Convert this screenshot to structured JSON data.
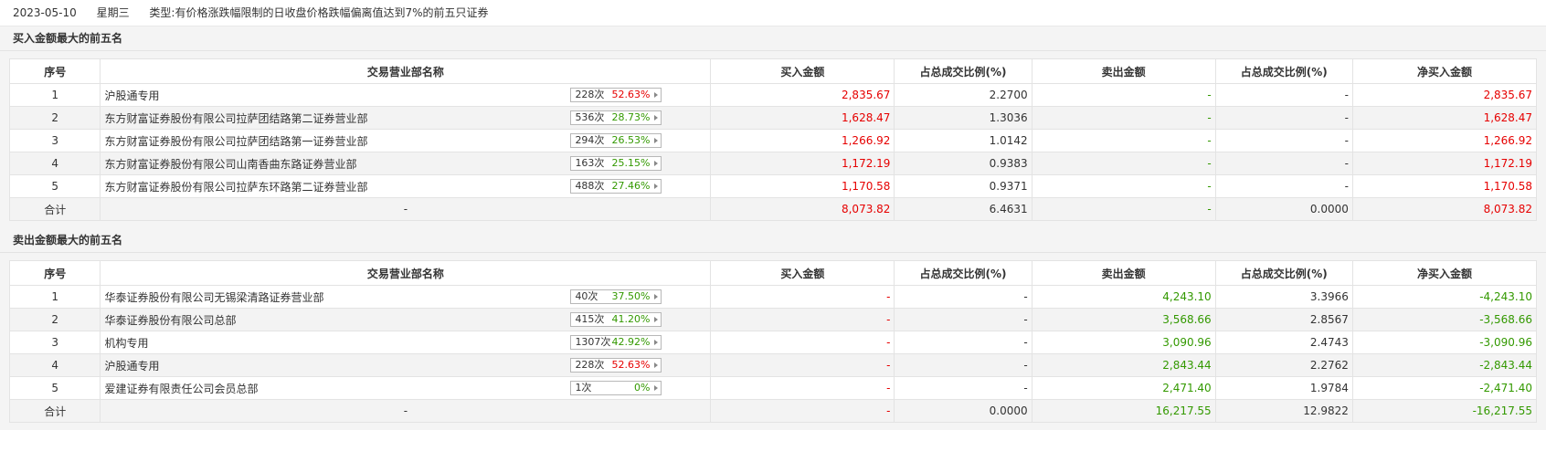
{
  "info": {
    "date": "2023-05-10",
    "weekday": "星期三",
    "type_label": "类型:",
    "type_text": "有价格涨跌幅限制的日收盘价格跌幅偏离值达到7%的前五只证券"
  },
  "columns": {
    "rank": "序号",
    "name": "交易营业部名称",
    "buy": "买入金额",
    "buy_ratio": "占总成交比例(%)",
    "sell": "卖出金额",
    "sell_ratio": "占总成交比例(%)",
    "net": "净买入金额"
  },
  "buy_section": {
    "title": "买入金额最大的前五名",
    "rows": [
      {
        "rank": "1",
        "name": "沪股通专用",
        "times": "228次",
        "pct": "52.63%",
        "pct_color": "red",
        "buy": "2,835.67",
        "buy_ratio": "2.2700",
        "sell": "-",
        "sell_ratio": "-",
        "net": "2,835.67"
      },
      {
        "rank": "2",
        "name": "东方财富证券股份有限公司拉萨团结路第二证券营业部",
        "times": "536次",
        "pct": "28.73%",
        "pct_color": "green",
        "buy": "1,628.47",
        "buy_ratio": "1.3036",
        "sell": "-",
        "sell_ratio": "-",
        "net": "1,628.47"
      },
      {
        "rank": "3",
        "name": "东方财富证券股份有限公司拉萨团结路第一证券营业部",
        "times": "294次",
        "pct": "26.53%",
        "pct_color": "green",
        "buy": "1,266.92",
        "buy_ratio": "1.0142",
        "sell": "-",
        "sell_ratio": "-",
        "net": "1,266.92"
      },
      {
        "rank": "4",
        "name": "东方财富证券股份有限公司山南香曲东路证券营业部",
        "times": "163次",
        "pct": "25.15%",
        "pct_color": "green",
        "buy": "1,172.19",
        "buy_ratio": "0.9383",
        "sell": "-",
        "sell_ratio": "-",
        "net": "1,172.19"
      },
      {
        "rank": "5",
        "name": "东方财富证券股份有限公司拉萨东环路第二证券营业部",
        "times": "488次",
        "pct": "27.46%",
        "pct_color": "green",
        "buy": "1,170.58",
        "buy_ratio": "0.9371",
        "sell": "-",
        "sell_ratio": "-",
        "net": "1,170.58"
      }
    ],
    "total": {
      "rank": "合计",
      "name": "-",
      "buy": "8,073.82",
      "buy_ratio": "6.4631",
      "sell": "-",
      "sell_ratio": "0.0000",
      "net": "8,073.82"
    }
  },
  "sell_section": {
    "title": "卖出金额最大的前五名",
    "rows": [
      {
        "rank": "1",
        "name": "华泰证券股份有限公司无锡梁清路证券营业部",
        "times": "40次",
        "pct": "37.50%",
        "pct_color": "green",
        "buy": "-",
        "buy_ratio": "-",
        "sell": "4,243.10",
        "sell_ratio": "3.3966",
        "net": "-4,243.10"
      },
      {
        "rank": "2",
        "name": "华泰证券股份有限公司总部",
        "times": "415次",
        "pct": "41.20%",
        "pct_color": "green",
        "buy": "-",
        "buy_ratio": "-",
        "sell": "3,568.66",
        "sell_ratio": "2.8567",
        "net": "-3,568.66"
      },
      {
        "rank": "3",
        "name": "机构专用",
        "times": "1307次",
        "pct": "42.92%",
        "pct_color": "green",
        "buy": "-",
        "buy_ratio": "-",
        "sell": "3,090.96",
        "sell_ratio": "2.4743",
        "net": "-3,090.96"
      },
      {
        "rank": "4",
        "name": "沪股通专用",
        "times": "228次",
        "pct": "52.63%",
        "pct_color": "red",
        "buy": "-",
        "buy_ratio": "-",
        "sell": "2,843.44",
        "sell_ratio": "2.2762",
        "net": "-2,843.44"
      },
      {
        "rank": "5",
        "name": "爱建证券有限责任公司会员总部",
        "times": "1次",
        "pct": "0%",
        "pct_color": "green",
        "buy": "-",
        "buy_ratio": "-",
        "sell": "2,471.40",
        "sell_ratio": "1.9784",
        "net": "-2,471.40"
      }
    ],
    "total": {
      "rank": "合计",
      "name": "-",
      "buy": "-",
      "buy_ratio": "0.0000",
      "sell": "16,217.55",
      "sell_ratio": "12.9822",
      "net": "-16,217.55"
    }
  },
  "colors": {
    "up": "#e60000",
    "down": "#339900"
  }
}
